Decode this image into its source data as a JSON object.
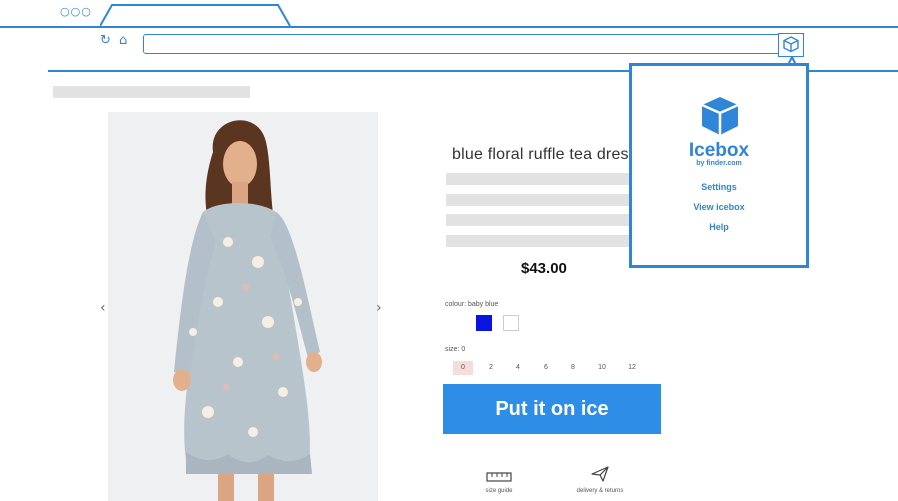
{
  "browser": {
    "window_dots": "○○○",
    "url": ""
  },
  "extension": {
    "icon": "icebox-cube-icon"
  },
  "product": {
    "title": "blue floral ruffle tea dress",
    "price": "$43.00",
    "colour_label": "colour: baby blue",
    "colours": [
      "#0a14e0",
      "#ffffff"
    ],
    "size_label": "size: 0",
    "sizes": [
      "0",
      "2",
      "4",
      "6",
      "8",
      "10",
      "12"
    ],
    "selected_size": "0",
    "cta": "Put it on ice",
    "size_guide_label": "size guide",
    "delivery_label": "delivery & returns"
  },
  "popup": {
    "brand": "Icebox",
    "byline": "by finder.com",
    "links": [
      "Settings",
      "View icebox",
      "Help"
    ]
  },
  "colors": {
    "accent": "#2f86d8",
    "button": "#2e8de6",
    "selected_size_bg": "#f6dcdc"
  }
}
